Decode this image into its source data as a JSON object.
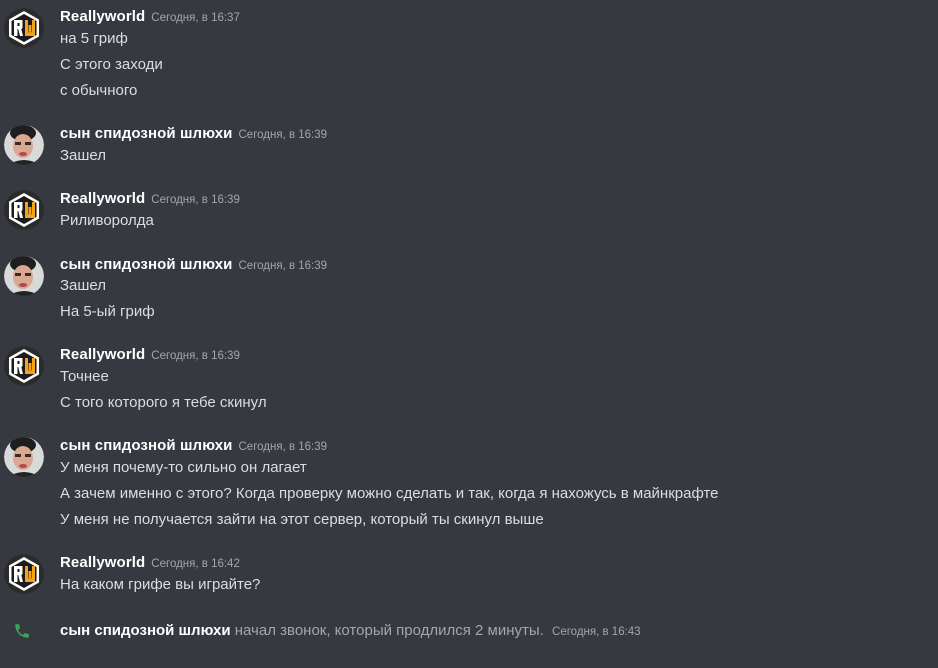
{
  "users": {
    "rw": "Reallyworld",
    "son": "сын  спидозной шлюхи"
  },
  "messages": [
    {
      "user": "Reallyworld",
      "time": "Сегодня, в 16:37",
      "lines": [
        "на 5 гриф",
        "С этого заходи",
        "с обычного"
      ]
    },
    {
      "user": "сын  спидозной шлюхи",
      "time": "Сегодня, в 16:39",
      "lines": [
        "Зашел"
      ]
    },
    {
      "user": "Reallyworld",
      "time": "Сегодня, в 16:39",
      "lines": [
        "Риливоролда"
      ]
    },
    {
      "user": "сын  спидозной шлюхи",
      "time": "Сегодня, в 16:39",
      "lines": [
        "Зашел",
        "На 5-ый гриф"
      ]
    },
    {
      "user": "Reallyworld",
      "time": "Сегодня, в 16:39",
      "lines": [
        "Точнее",
        "С того которого я тебе скинул"
      ]
    },
    {
      "user": "сын  спидозной шлюхи",
      "time": "Сегодня, в 16:39",
      "lines": [
        "У меня почему-то сильно он лагает",
        "А зачем именно с этого? Когда проверку можно сделать и так, когда я нахожусь в майнкрафте",
        "У меня не получается зайти на этот сервер, который ты скинул выше"
      ]
    },
    {
      "user": "Reallyworld",
      "time": "Сегодня, в 16:42",
      "lines": [
        "На каком грифе вы играйте?"
      ]
    }
  ],
  "call": {
    "user": "сын  спидозной шлюхи",
    "description": "начал звонок, который продлился 2 минуты.",
    "time": "Сегодня, в 16:43",
    "icon": "phone-icon",
    "icon_color": "#3ba55d"
  },
  "colors": {
    "background": "#36393f",
    "username": "#ffffff",
    "text": "#dcddde",
    "muted": "#a3a6aa",
    "rw_orange": "#f5a21b"
  }
}
